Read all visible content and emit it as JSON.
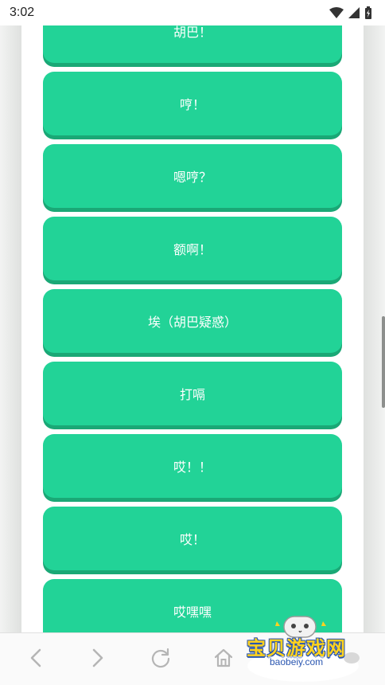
{
  "status_bar": {
    "time": "3:02",
    "icons": [
      "wifi-icon",
      "cell-signal-icon",
      "battery-charging-icon"
    ]
  },
  "sound_buttons": [
    {
      "label": "胡巴！"
    },
    {
      "label": "哼！"
    },
    {
      "label": "嗯哼？"
    },
    {
      "label": "额啊！"
    },
    {
      "label": "埃（胡巴疑惑）"
    },
    {
      "label": "打嗝"
    },
    {
      "label": "哎！！"
    },
    {
      "label": "哎！"
    },
    {
      "label": "哎嘿嘿"
    }
  ],
  "navigation": {
    "icons": [
      "back-arrow-icon",
      "forward-arrow-icon",
      "reload-icon",
      "home-icon"
    ]
  },
  "watermark": {
    "title": "宝贝游戏网",
    "url": "baobeiy.com",
    "icon": "gamepad-mascot-icon"
  },
  "colors": {
    "button_green": "#22d397",
    "button_shadow": "#1aa876",
    "watermark_yellow": "#ffd21f",
    "watermark_blue": "#2a56b0"
  }
}
